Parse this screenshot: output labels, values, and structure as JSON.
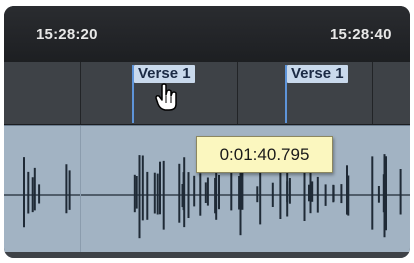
{
  "ruler": {
    "time_left": "15:28:20",
    "time_right": "15:28:40"
  },
  "markers": [
    {
      "label": "Verse 1"
    },
    {
      "label": "Verse 1"
    }
  ],
  "tooltip": {
    "position": "0:01:40.795"
  },
  "icons": {
    "cursor": "hand-pointer-icon"
  },
  "colors": {
    "marker_line": "#5e94d9",
    "marker_label_bg": "#c9d9ec",
    "track_bg": "#a2b3c3",
    "tooltip_bg": "#fbf7bf"
  }
}
